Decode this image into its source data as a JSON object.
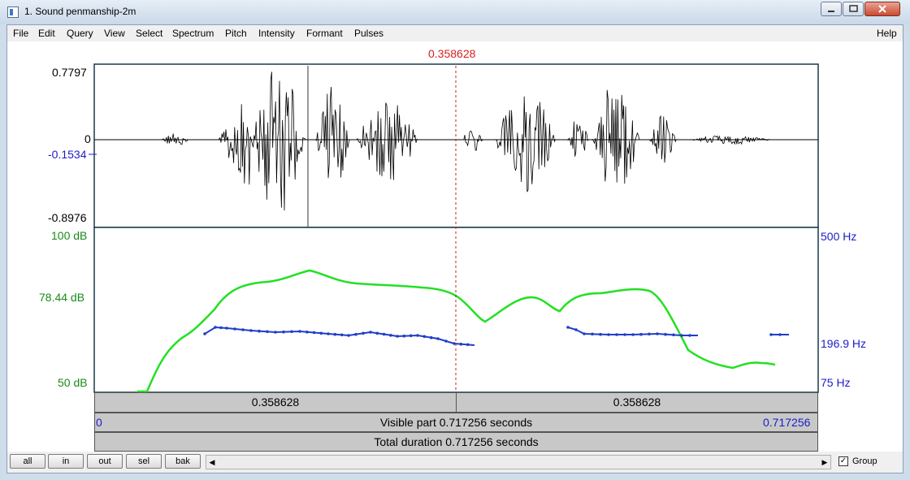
{
  "window": {
    "title": "1. Sound penmanship-2m"
  },
  "menu": [
    "File",
    "Edit",
    "Query",
    "View",
    "Select",
    "Spectrum",
    "Pitch",
    "Intensity",
    "Formant",
    "Pulses"
  ],
  "help_label": "Help",
  "cursor": {
    "time_label": "0.358628"
  },
  "waveform": {
    "max_label": "0.7797",
    "zero_label": "0",
    "cursor_value_label": "-0.1534",
    "min_label": "-0.8976"
  },
  "intensity": {
    "top_label": "100 dB",
    "mid_label": "78.44 dB",
    "bottom_label": "50 dB"
  },
  "pitch": {
    "top_label": "500 Hz",
    "mid_label": "196.9 Hz",
    "bottom_label": "75 Hz"
  },
  "time_bar": {
    "left_segment": "0.358628",
    "right_segment": "0.358628"
  },
  "visible": {
    "start": "0",
    "label": "Visible part 0.717256 seconds",
    "end": "0.717256"
  },
  "total": {
    "label": "Total duration 0.717256 seconds"
  },
  "footer": {
    "buttons": [
      "all",
      "in",
      "out",
      "sel",
      "bak"
    ],
    "group_label": "Group",
    "group_checked": true
  },
  "colors": {
    "intensity": "#22e022",
    "pitch": "#1f3fc8",
    "cursor": "#c02020"
  }
}
